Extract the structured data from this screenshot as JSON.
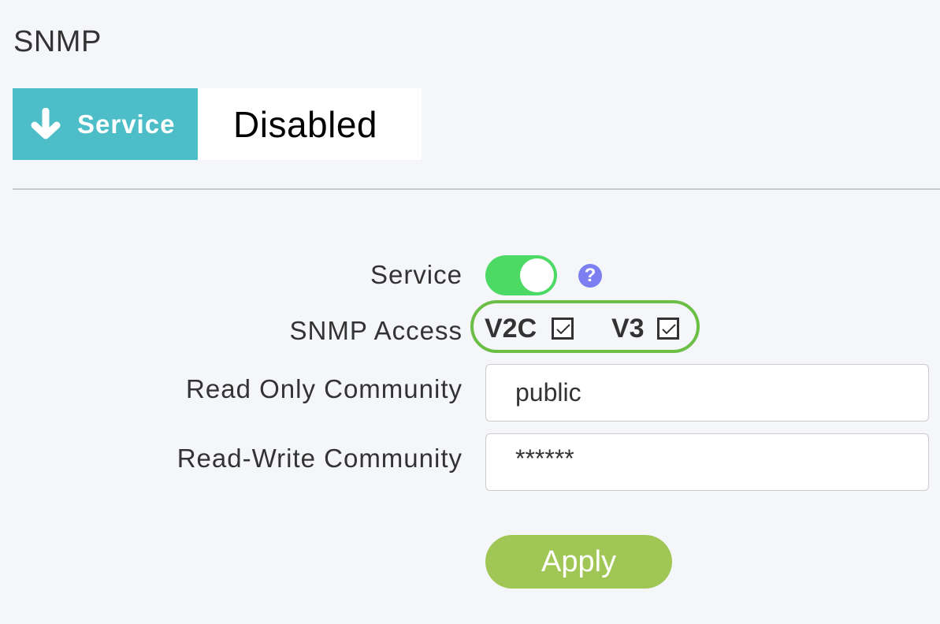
{
  "page": {
    "title": "SNMP"
  },
  "service_banner": {
    "label": "Service",
    "status": "Disabled",
    "icon": "arrow-down-icon",
    "accent": "#4dbec7"
  },
  "form": {
    "service": {
      "label": "Service",
      "enabled": true,
      "help_icon": "question-icon"
    },
    "snmp_access": {
      "label": "SNMP Access",
      "options": [
        {
          "label": "V2C",
          "checked": true
        },
        {
          "label": "V3",
          "checked": true
        }
      ]
    },
    "read_only_community": {
      "label": "Read Only Community",
      "value": "public"
    },
    "read_write_community": {
      "label": "Read-Write Community",
      "value": "******"
    },
    "apply_label": "Apply"
  }
}
